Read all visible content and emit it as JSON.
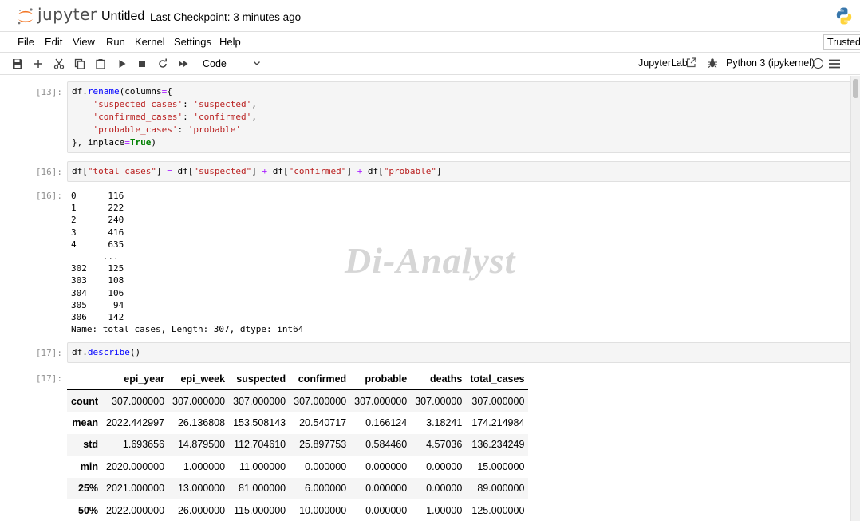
{
  "header": {
    "logo_text": "jupyter",
    "notebook_title": "Untitled",
    "checkpoint": "Last Checkpoint: 3 minutes ago"
  },
  "menu": [
    "File",
    "Edit",
    "View",
    "Run",
    "Kernel",
    "Settings",
    "Help"
  ],
  "trusted_label": "Trusted",
  "toolbar": {
    "cell_type": "Code",
    "jupyterlab_label": "JupyterLab",
    "kernel_label": "Python 3 (ipykernel)"
  },
  "cells": {
    "c13": {
      "prompt": "[13]:",
      "lines": [
        "df.rename(columns={",
        "    'suspected_cases': 'suspected',",
        "    'confirmed_cases': 'confirmed',",
        "    'probable_cases': 'probable'",
        "}, inplace=True)"
      ]
    },
    "c16": {
      "prompt": "[16]:",
      "code": "df[\"total_cases\"] = df[\"suspected\"] + df[\"confirmed\"] + df[\"probable\"]",
      "out_prompt": "[16]:",
      "output_lines": [
        "0      116",
        "1      222",
        "2      240",
        "3      416",
        "4      635",
        "      ...",
        "302    125",
        "303    108",
        "304    106",
        "305     94",
        "306    142",
        "Name: total_cases, Length: 307, dtype: int64"
      ]
    },
    "c17": {
      "prompt": "[17]:",
      "code": "df.describe()",
      "out_prompt": "[17]:"
    }
  },
  "watermark": "Di-Analyst",
  "describe_table": {
    "columns": [
      "",
      "epi_year",
      "epi_week",
      "suspected",
      "confirmed",
      "probable",
      "deaths",
      "total_cases"
    ],
    "rows": [
      [
        "count",
        "307.000000",
        "307.000000",
        "307.000000",
        "307.000000",
        "307.000000",
        "307.00000",
        "307.000000"
      ],
      [
        "mean",
        "2022.442997",
        "26.136808",
        "153.508143",
        "20.540717",
        "0.166124",
        "3.18241",
        "174.214984"
      ],
      [
        "std",
        "1.693656",
        "14.879500",
        "112.704610",
        "25.897753",
        "0.584460",
        "4.57036",
        "136.234249"
      ],
      [
        "min",
        "2020.000000",
        "1.000000",
        "11.000000",
        "0.000000",
        "0.000000",
        "0.00000",
        "15.000000"
      ],
      [
        "25%",
        "2021.000000",
        "13.000000",
        "81.000000",
        "6.000000",
        "0.000000",
        "0.00000",
        "89.000000"
      ],
      [
        "50%",
        "2022.000000",
        "26.000000",
        "115.000000",
        "10.000000",
        "0.000000",
        "1.00000",
        "125.000000"
      ]
    ]
  },
  "colors": {
    "jupyter_orange": "#f37626",
    "string_red": "#ba2121",
    "keyword_green": "#008000",
    "operator_purple": "#aa22ff"
  }
}
